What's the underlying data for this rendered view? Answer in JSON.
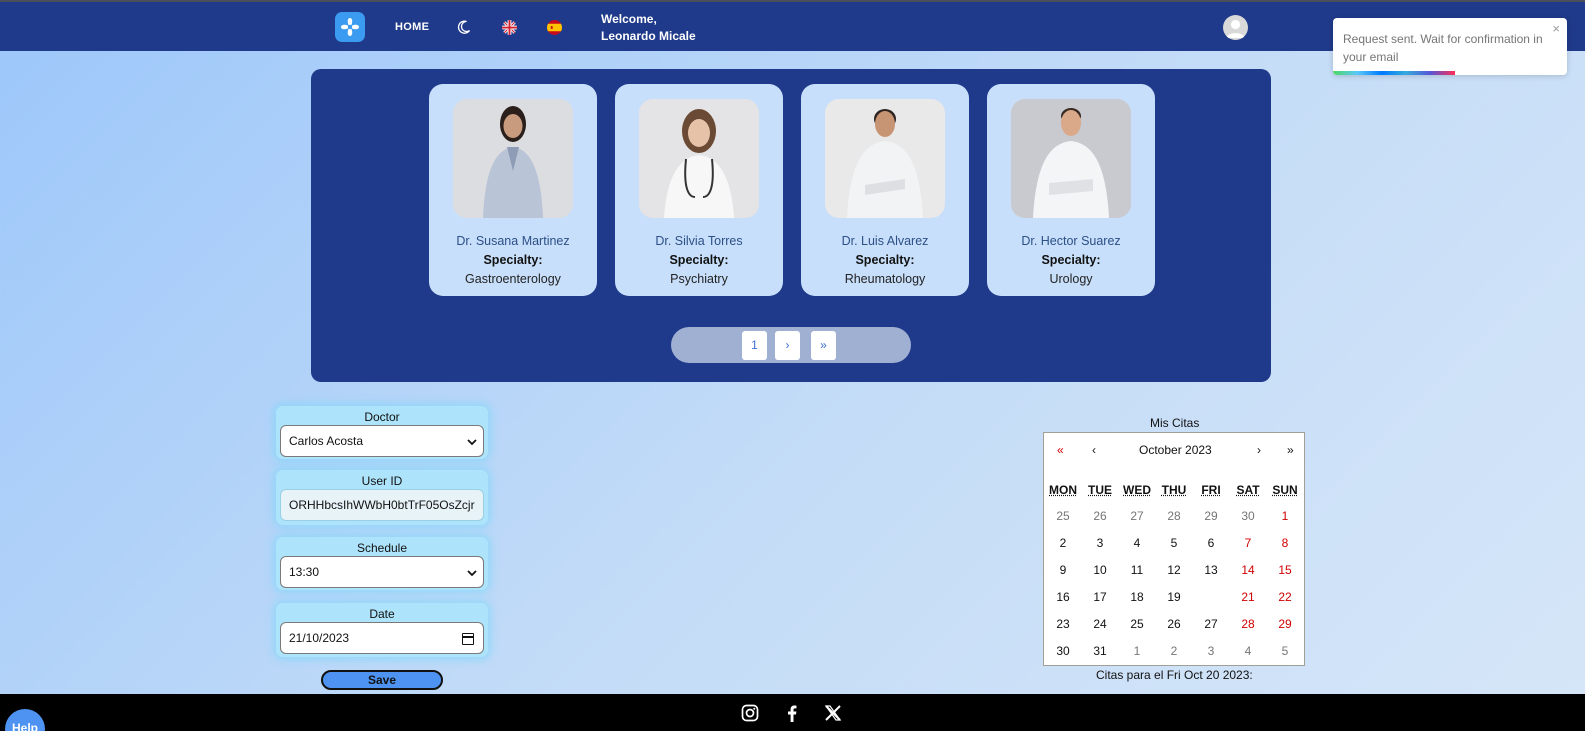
{
  "nav": {
    "home_label": "HOME",
    "welcome_line1": "Welcome,",
    "welcome_line2": "Leonardo Micale",
    "icons": [
      "app-logo-icon",
      "moon-icon",
      "uk-flag-icon",
      "spain-flag-icon",
      "user-avatar-icon"
    ]
  },
  "toast": {
    "message": "Request sent. Wait for confirmation in your email",
    "close_label": "×",
    "progress_fraction": 0.52
  },
  "doctors": [
    {
      "name": "Dr. Susana Martinez",
      "specialty_label": "Specialty:",
      "specialty": "Gastroenterology"
    },
    {
      "name": "Dr. Silvia Torres",
      "specialty_label": "Specialty:",
      "specialty": "Psychiatry"
    },
    {
      "name": "Dr. Luis Alvarez",
      "specialty_label": "Specialty:",
      "specialty": "Rheumatology"
    },
    {
      "name": "Dr. Hector Suarez",
      "specialty_label": "Specialty:",
      "specialty": "Urology"
    }
  ],
  "pager": {
    "current": "1",
    "next": "›",
    "last": "»"
  },
  "form": {
    "doctor_label": "Doctor",
    "doctor_value": "Carlos Acosta",
    "userid_label": "User ID",
    "userid_value": "ORHHbcsIhWWbH0btTrF05OsZcjr",
    "schedule_label": "Schedule",
    "schedule_value": "13:30",
    "date_label": "Date",
    "date_value": "21/10/2023",
    "save_label": "Save"
  },
  "calendar": {
    "title": "Mis Citas",
    "month_label": "October 2023",
    "nav": {
      "prev_year": "«",
      "prev_month": "‹",
      "next_month": "›",
      "next_year": "»"
    },
    "weekdays": [
      "MON",
      "TUE",
      "WED",
      "THU",
      "FRI",
      "SAT",
      "SUN"
    ],
    "weeks": [
      [
        "25",
        "26",
        "27",
        "28",
        "29",
        "30",
        "1"
      ],
      [
        "2",
        "3",
        "4",
        "5",
        "6",
        "7",
        "8"
      ],
      [
        "9",
        "10",
        "11",
        "12",
        "13",
        "14",
        "15"
      ],
      [
        "16",
        "17",
        "18",
        "19",
        "",
        "21",
        "22"
      ],
      [
        "23",
        "24",
        "25",
        "26",
        "27",
        "28",
        "29"
      ],
      [
        "30",
        "31",
        "1",
        "2",
        "3",
        "4",
        "5"
      ]
    ],
    "footer_text": "Citas para el Fri Oct 20 2023:"
  },
  "colors": {
    "navbar": "#1f3a8a",
    "card": "#c7dffb",
    "accent_blue": "#4f93f2",
    "weekend_red": "#d10000"
  },
  "footer": {
    "icons": [
      "instagram-icon",
      "facebook-icon",
      "x-twitter-icon"
    ]
  },
  "help": {
    "label": "Help"
  }
}
